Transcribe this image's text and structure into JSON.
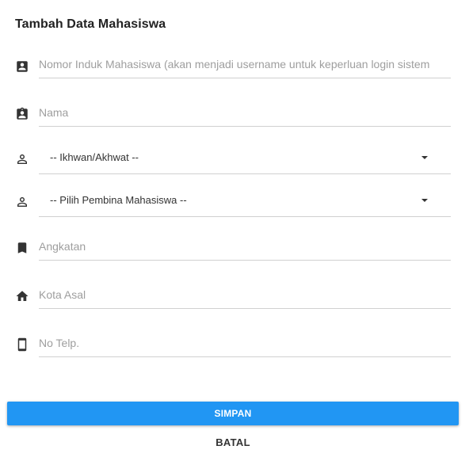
{
  "form": {
    "title": "Tambah Data Mahasiswa",
    "fields": [
      {
        "icon": "account-box-icon",
        "placeholder": "Nomor Induk Mahasiswa (akan menjadi username untuk keperluan login sistem"
      },
      {
        "icon": "assignment-ind-icon",
        "placeholder": "Nama"
      },
      {
        "icon": "person-outline-icon",
        "selected": "-- Ikhwan/Akhwat --"
      },
      {
        "icon": "person-outline-icon",
        "selected": "-- Pilih Pembina Mahasiswa --"
      },
      {
        "icon": "bookmark-icon",
        "placeholder": "Angkatan"
      },
      {
        "icon": "home-icon",
        "placeholder": "Kota Asal"
      },
      {
        "icon": "smartphone-icon",
        "placeholder": "No Telp."
      }
    ]
  },
  "buttons": {
    "submit_label": "SIMPAN",
    "cancel_label": "BATAL"
  },
  "colors": {
    "primary": "#2196f3",
    "icon": "#333333",
    "placeholder": "#9e9e9e",
    "underline": "#d0d0d0"
  }
}
